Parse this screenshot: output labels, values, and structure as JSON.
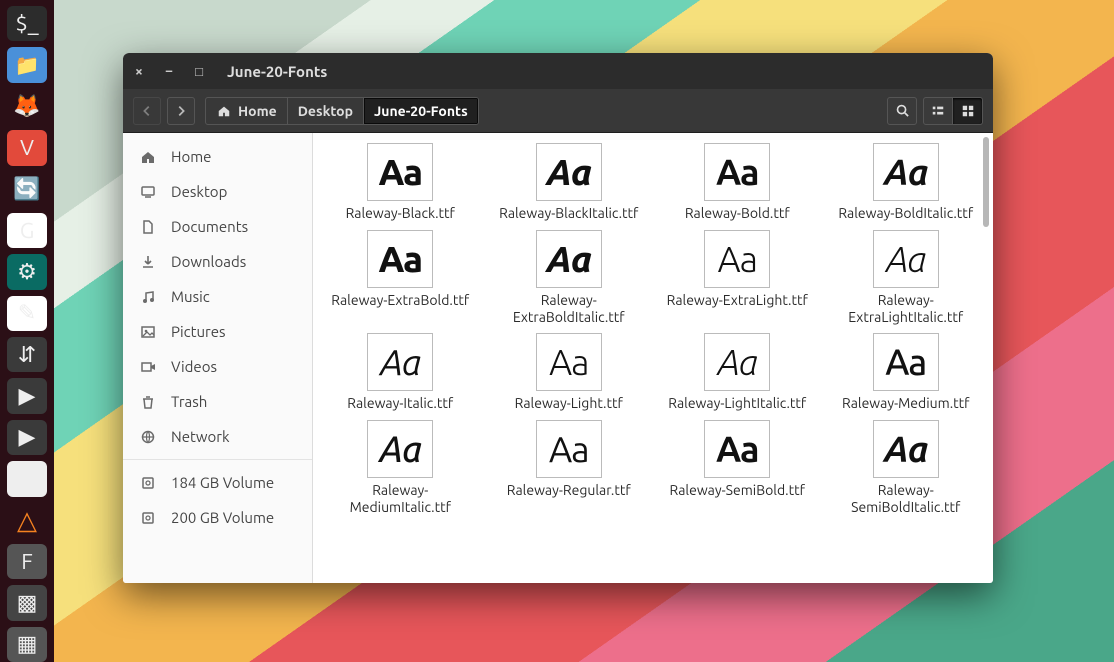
{
  "window": {
    "title": "June-20-Fonts"
  },
  "breadcrumb": [
    {
      "label": "Home",
      "icon": "home-icon",
      "active": false
    },
    {
      "label": "Desktop",
      "active": false
    },
    {
      "label": "June-20-Fonts",
      "active": true
    }
  ],
  "sidebar": {
    "places": [
      {
        "label": "Home",
        "icon": "home-icon"
      },
      {
        "label": "Desktop",
        "icon": "desktop-icon"
      },
      {
        "label": "Documents",
        "icon": "documents-icon"
      },
      {
        "label": "Downloads",
        "icon": "downloads-icon"
      },
      {
        "label": "Music",
        "icon": "music-icon"
      },
      {
        "label": "Pictures",
        "icon": "pictures-icon"
      },
      {
        "label": "Videos",
        "icon": "videos-icon"
      },
      {
        "label": "Trash",
        "icon": "trash-icon"
      },
      {
        "label": "Network",
        "icon": "network-icon"
      }
    ],
    "devices": [
      {
        "label": "184 GB Volume",
        "icon": "disk-icon"
      },
      {
        "label": "200 GB Volume",
        "icon": "disk-icon"
      }
    ]
  },
  "files": [
    {
      "name": "Raleway-Black.ttf",
      "weight": 900,
      "italic": false
    },
    {
      "name": "Raleway-BlackItalic.ttf",
      "weight": 900,
      "italic": true
    },
    {
      "name": "Raleway-Bold.ttf",
      "weight": 700,
      "italic": false
    },
    {
      "name": "Raleway-BoldItalic.ttf",
      "weight": 700,
      "italic": true
    },
    {
      "name": "Raleway-ExtraBold.ttf",
      "weight": 800,
      "italic": false
    },
    {
      "name": "Raleway-ExtraBoldItalic.ttf",
      "weight": 800,
      "italic": true
    },
    {
      "name": "Raleway-ExtraLight.ttf",
      "weight": 200,
      "italic": false
    },
    {
      "name": "Raleway-ExtraLightItalic.ttf",
      "weight": 200,
      "italic": true
    },
    {
      "name": "Raleway-Italic.ttf",
      "weight": 400,
      "italic": true
    },
    {
      "name": "Raleway-Light.ttf",
      "weight": 300,
      "italic": false
    },
    {
      "name": "Raleway-LightItalic.ttf",
      "weight": 300,
      "italic": true
    },
    {
      "name": "Raleway-Medium.ttf",
      "weight": 500,
      "italic": false
    },
    {
      "name": "Raleway-MediumItalic.ttf",
      "weight": 500,
      "italic": true
    },
    {
      "name": "Raleway-Regular.ttf",
      "weight": 400,
      "italic": false
    },
    {
      "name": "Raleway-SemiBold.ttf",
      "weight": 600,
      "italic": false
    },
    {
      "name": "Raleway-SemiBoldItalic.ttf",
      "weight": 600,
      "italic": true
    }
  ],
  "glyph_sample": "Aa",
  "dock": [
    {
      "name": "terminal",
      "bg": "#2c2c2c",
      "glyph": "$_"
    },
    {
      "name": "files",
      "bg": "#4a90d9",
      "glyph": "📁"
    },
    {
      "name": "firefox",
      "bg": "transparent",
      "glyph": "🦊"
    },
    {
      "name": "vivaldi",
      "bg": "#e24a3b",
      "glyph": "V"
    },
    {
      "name": "sync",
      "bg": "transparent",
      "glyph": "🔄"
    },
    {
      "name": "google-app",
      "bg": "#ffffff",
      "glyph": "G"
    },
    {
      "name": "settings-tool",
      "bg": "#0a6b63",
      "glyph": "⚙"
    },
    {
      "name": "notes",
      "bg": "#ffffff",
      "glyph": "✎"
    },
    {
      "name": "transmission",
      "bg": "#3a3a3a",
      "glyph": "⇵"
    },
    {
      "name": "mpv",
      "bg": "#3a3a3a",
      "glyph": "▶"
    },
    {
      "name": "player",
      "bg": "#3a3a3a",
      "glyph": "▶"
    },
    {
      "name": "software",
      "bg": "#eeeeee",
      "glyph": "🛍"
    },
    {
      "name": "vlc",
      "bg": "transparent",
      "glyph": "△"
    },
    {
      "name": "font-manager",
      "bg": "#555555",
      "glyph": "F"
    },
    {
      "name": "screenshot",
      "bg": "#444444",
      "glyph": "▩"
    },
    {
      "name": "app",
      "bg": "#555555",
      "glyph": "▦"
    }
  ]
}
